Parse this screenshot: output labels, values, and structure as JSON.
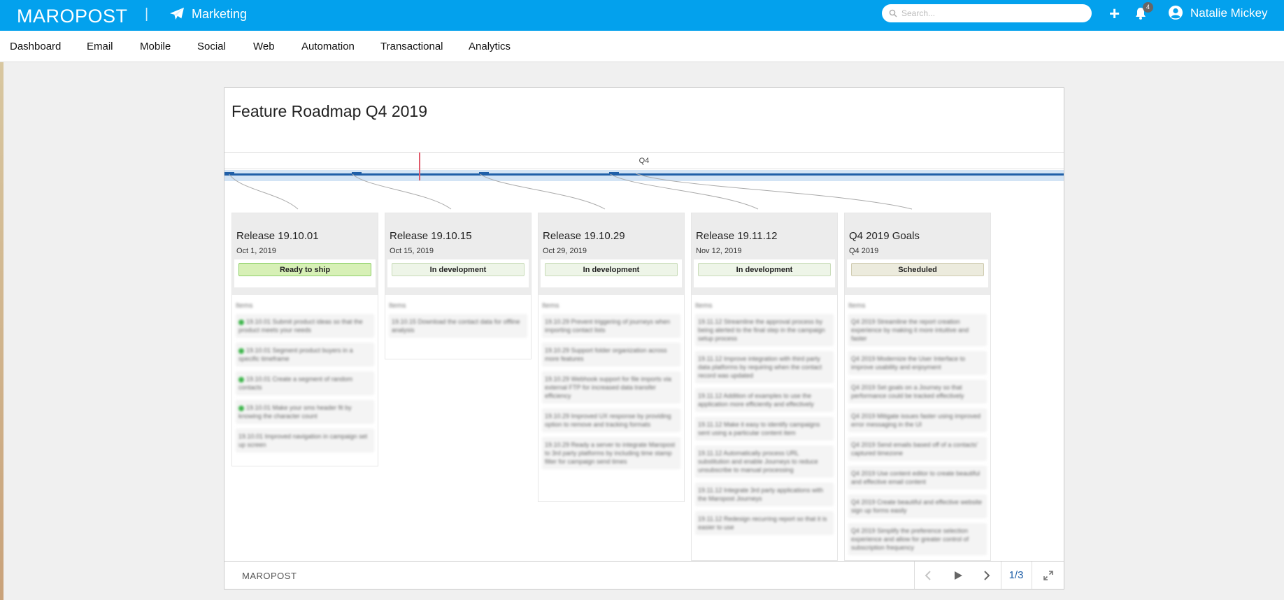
{
  "header": {
    "brand": "MAROPOST",
    "divider": "|",
    "app_name": "Marketing",
    "search_placeholder": "Search...",
    "notification_count": "4",
    "user_name": "Natalie Mickey",
    "icons": [
      "paper-plane-icon",
      "search-icon",
      "plus-icon",
      "bell-icon",
      "user-avatar-icon"
    ]
  },
  "nav": {
    "items": [
      "Dashboard",
      "Email",
      "Mobile",
      "Social",
      "Web",
      "Automation",
      "Transactional",
      "Analytics"
    ]
  },
  "roadmap": {
    "title": "Feature Roadmap Q4 2019",
    "timeline_label": "Q4",
    "releases": [
      {
        "name": "Release 19.10.01",
        "date": "Oct 1, 2019",
        "status": "Ready to ship",
        "body_label": "Items",
        "features": [
          "19.10.01 Submit product ideas so that the product meets your needs",
          "19.10.01 Segment product buyers in a specific timeframe",
          "19.10.01 Create a segment of random contacts",
          "19.10.01 Make your sms header fit by knowing the character count",
          "19.10.01 Improved navigation in campaign set up screen"
        ]
      },
      {
        "name": "Release 19.10.15",
        "date": "Oct 15, 2019",
        "status": "In development",
        "body_label": "Items",
        "features": [
          "19.10.15 Download the contact data for offline analysis"
        ]
      },
      {
        "name": "Release 19.10.29",
        "date": "Oct 29, 2019",
        "status": "In development",
        "body_label": "Items",
        "features": [
          "19.10.29 Prevent triggering of journeys when importing contact lists",
          "19.10.29 Support folder organization across more features",
          "19.10.29 Webhook support for file imports via external FTP for increased data transfer efficiency",
          "19.10.29 Improved UX response by providing option to remove and tracking formats",
          "19.10.29 Ready a server to integrate Maropost to 3rd party platforms by including time stamp filter for campaign send times"
        ]
      },
      {
        "name": "Release 19.11.12",
        "date": "Nov 12, 2019",
        "status": "In development",
        "body_label": "Items",
        "features": [
          "19.11.12 Streamline the approval process by being alerted to the final step in the campaign setup process",
          "19.11.12 Improve integration with third party data platforms by requiring when the contact record was updated",
          "19.11.12 Addition of examples to use the application more efficiently and effectively",
          "19.11.12 Make it easy to identify campaigns sent using a particular content item",
          "19.11.12 Automatically process URL substitution and enable Journeys to reduce unsubscribe to manual processing",
          "19.11.12 Integrate 3rd party applications with the Maropost Journeys",
          "19.11.12 Redesign recurring report so that it is easier to use"
        ]
      },
      {
        "name": "Q4 2019 Goals",
        "date": "Q4 2019",
        "status": "Scheduled",
        "body_label": "Items",
        "features": [
          "Q4 2019 Streamline the report creation experience by making it more intuitive and faster",
          "Q4 2019 Modernize the User Interface to improve usability and enjoyment",
          "Q4 2019 Set goals on a Journey so that performance could be tracked effectively",
          "Q4 2019 Mitigate issues faster using improved error messaging in the UI",
          "Q4 2019 Send emails based off of a contacts' captured timezone",
          "Q4 2019 Use content editor to create beautiful and effective email content",
          "Q4 2019 Create beautiful and effective website sign up forms easily",
          "Q4 2019 Simplify the preference selection experience and allow for greater control of subscription frequency"
        ]
      }
    ]
  },
  "footer": {
    "brand": "MAROPOST",
    "page_indicator": "1/3",
    "icons": [
      "chevron-left-icon",
      "play-icon",
      "chevron-right-icon",
      "expand-icon"
    ]
  },
  "colors": {
    "header_bg": "#03a1ed",
    "timeline_line": "#1f5fa8",
    "today_marker": "#e05a6b",
    "ready": "#d7f0b6",
    "dev": "#eef5e8",
    "scheduled": "#ecebdd"
  }
}
